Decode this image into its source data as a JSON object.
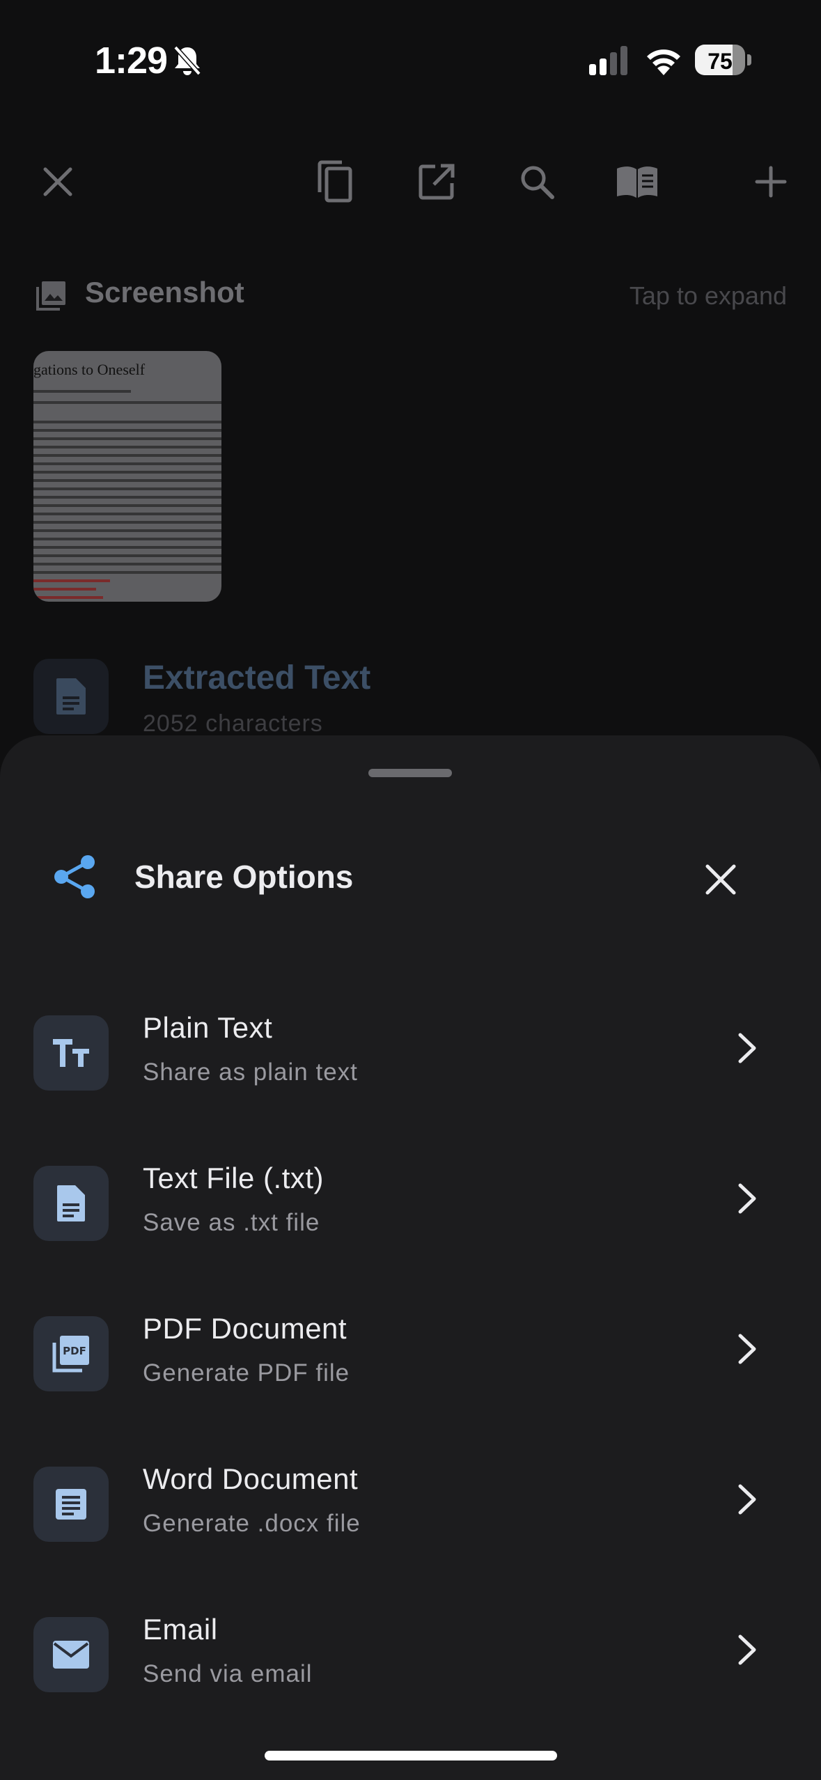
{
  "status_bar": {
    "time": "1:29",
    "battery": "75",
    "battery_level": 0.75
  },
  "toolbar": {
    "close_icon": "close-icon",
    "copy_icon": "copy-icon",
    "open_external_icon": "open-external-icon",
    "search_icon": "search-icon",
    "reader_icon": "book-icon",
    "add_icon": "plus-icon"
  },
  "background": {
    "section_label": "Screenshot",
    "tap_hint": "Tap to expand",
    "thumbnail_title": "gations to Oneself",
    "extracted_title": "Extracted Text",
    "extracted_sub": "2052 characters"
  },
  "sheet": {
    "title": "Share Options",
    "options": [
      {
        "title": "Plain Text",
        "subtitle": "Share as plain text",
        "icon": "text-format-icon"
      },
      {
        "title": "Text File (.txt)",
        "subtitle": "Save as .txt file",
        "icon": "document-icon"
      },
      {
        "title": "PDF Document",
        "subtitle": "Generate PDF file",
        "icon": "pdf-icon"
      },
      {
        "title": "Word Document",
        "subtitle": "Generate .docx file",
        "icon": "word-doc-icon"
      },
      {
        "title": "Email",
        "subtitle": "Send via email",
        "icon": "email-icon"
      }
    ]
  },
  "colors": {
    "accent": "#5aa7f0",
    "sheet_bg": "#1c1c1e",
    "icon_tile": "#2b303a"
  }
}
